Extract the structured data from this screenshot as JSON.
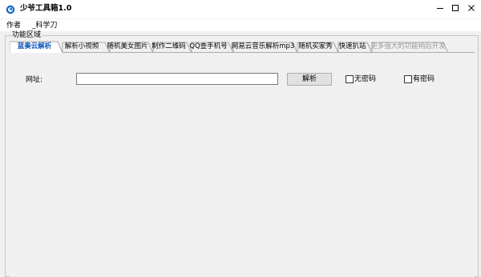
{
  "window": {
    "title": "少爷工具箱1.0",
    "minimize_glyph": "—",
    "maximize_glyph": "☐",
    "close_glyph": "✕"
  },
  "menu": {
    "items": [
      "作者",
      "_科学刀"
    ]
  },
  "group": {
    "label": "功能区域"
  },
  "tabs": [
    {
      "label": "蓝奏云解析",
      "state": "active"
    },
    {
      "label": "解析小视频",
      "state": "normal"
    },
    {
      "label": "随机美女图片",
      "state": "normal"
    },
    {
      "label": "制作二维码",
      "state": "normal"
    },
    {
      "label": "QQ查手机号",
      "state": "normal"
    },
    {
      "label": "网易云音乐解析mp3",
      "state": "normal"
    },
    {
      "label": "随机买家秀",
      "state": "normal"
    },
    {
      "label": "快速扒站",
      "state": "normal"
    },
    {
      "label": "更多强大的功能稍后开发",
      "state": "disabled"
    }
  ],
  "form": {
    "url_label": "网址:",
    "url_value": "",
    "parse_button": "解析",
    "no_password_label": "无密码",
    "no_password_checked": false,
    "has_password_label": "有密码",
    "has_password_checked": false
  },
  "colors": {
    "active_tab": "#0b55b8",
    "disabled_tab": "#9a9a9a",
    "window_bg": "#f0f0f0"
  }
}
